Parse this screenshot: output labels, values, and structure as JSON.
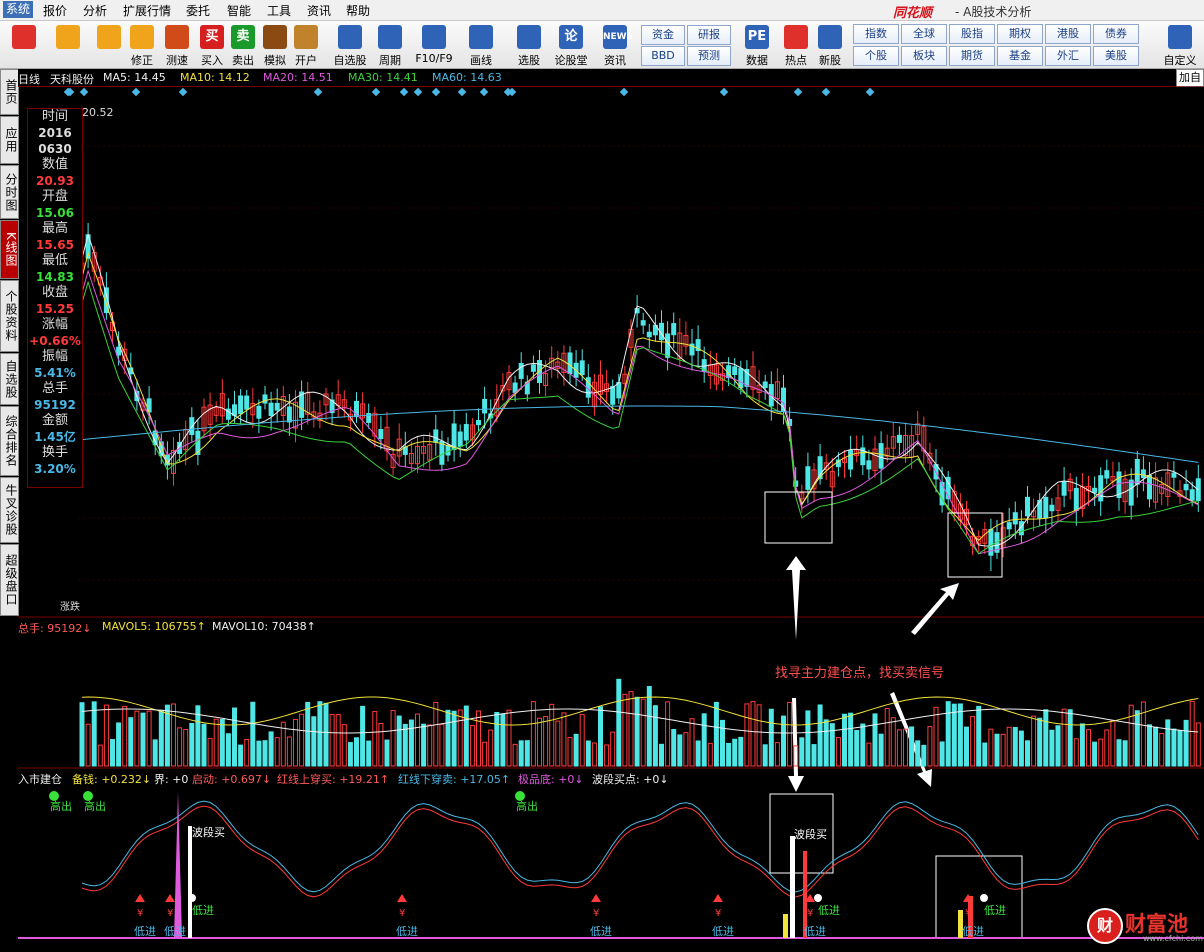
{
  "menubar": {
    "items": [
      "系统",
      "报价",
      "分析",
      "扩展行情",
      "委托",
      "智能",
      "工具",
      "资讯",
      "帮助"
    ],
    "brand": "同花顺",
    "subtitle": "- A股技术分析"
  },
  "toolbar": {
    "buttons": [
      {
        "label": "",
        "icon": "layout-icon",
        "color": "#e0302c"
      },
      {
        "label": "",
        "icon": "back-arrow-icon",
        "color": "#f0a41b"
      },
      {
        "label": "",
        "icon": "up-down-arrow-icon",
        "color": "#f0a41b"
      },
      {
        "label": "修正",
        "icon": "refresh-icon",
        "color": "#f0a41b"
      },
      {
        "label": "测速",
        "icon": "clock-icon",
        "color": "#d04a1a"
      },
      {
        "label": "买入",
        "icon": "buy-icon",
        "glyph": "买",
        "color": "#d62020"
      },
      {
        "label": "卖出",
        "icon": "sell-icon",
        "glyph": "卖",
        "color": "#1a9a2a"
      },
      {
        "label": "模拟",
        "icon": "hammer-icon",
        "color": "#8a4a12"
      },
      {
        "label": "开户",
        "icon": "lock-icon",
        "color": "#c0822a"
      },
      {
        "label": "自选股",
        "icon": "star-icon",
        "color": "#2f63b8"
      },
      {
        "label": "周期",
        "icon": "period-icon",
        "color": "#2f63b8"
      },
      {
        "label": "F10/F9",
        "icon": "f10-icon",
        "color": "#2f63b8"
      },
      {
        "label": "画线",
        "icon": "pen-icon",
        "color": "#2f63b8"
      },
      {
        "label": "选股",
        "icon": "screen-icon",
        "color": "#2f63b8"
      },
      {
        "label": "论股堂",
        "icon": "forum-icon",
        "glyph": "论",
        "color": "#2f63b8"
      },
      {
        "label": "资讯",
        "icon": "news-icon",
        "glyph": "NEWS",
        "color": "#2f63b8"
      },
      {
        "label": "数据",
        "icon": "pe-icon",
        "glyph": "PE",
        "color": "#2f63b8"
      },
      {
        "label": "热点",
        "icon": "hot-icon",
        "color": "#e0302c"
      },
      {
        "label": "新股",
        "icon": "new-stock-icon",
        "color": "#2f63b8"
      },
      {
        "label": "自定义",
        "icon": "custom-icon",
        "color": "#2f63b8"
      }
    ],
    "mid_buttons": [
      "资金",
      "研报",
      "BBD",
      "预测"
    ],
    "quick_buttons": [
      "指数",
      "全球",
      "股指",
      "期权",
      "港股",
      "债券",
      "个股",
      "板块",
      "期货",
      "基金",
      "外汇",
      "美股"
    ]
  },
  "sidetabs": [
    "首页",
    "应用",
    "分时图",
    "K线图",
    "个股资料",
    "自选股",
    "综合排名",
    "牛叉诊股",
    "超级盘口"
  ],
  "stock": {
    "period": "日线",
    "name": "天科股份",
    "ma": [
      {
        "label": "MA5: 14.45",
        "color": "#f0f0f0"
      },
      {
        "label": "MA10: 14.12",
        "color": "#f2e23a"
      },
      {
        "label": "MA20: 14.51",
        "color": "#e05ae0"
      },
      {
        "label": "MA30: 14.41",
        "color": "#3ad23a"
      },
      {
        "label": "MA60: 14.63",
        "color": "#4ab8e6"
      }
    ],
    "add_label": "加自"
  },
  "colors": {
    "up": "#ff3a3a",
    "down": "#4fe6e6",
    "ma5": "#f0f0f0",
    "ma10": "#f2e23a",
    "ma20": "#e05ae0",
    "ma30": "#3ad23a",
    "ma60": "#4ab8e6",
    "grid": "#7a0000"
  },
  "price_axis": {
    "max_label": "20.52",
    "tag": "涨跌"
  },
  "data_panel": [
    {
      "label": "时间",
      "value": "2016",
      "color": "#dddddd"
    },
    {
      "label": "",
      "value": "0630",
      "color": "#dddddd"
    },
    {
      "label": "数值",
      "value": "20.93",
      "color": "#ff3a3a"
    },
    {
      "label": "开盘",
      "value": "15.06",
      "color": "#3ae03a"
    },
    {
      "label": "最高",
      "value": "15.65",
      "color": "#ff3a3a"
    },
    {
      "label": "最低",
      "value": "14.83",
      "color": "#3ae03a"
    },
    {
      "label": "收盘",
      "value": "15.25",
      "color": "#ff3a3a"
    },
    {
      "label": "涨幅",
      "value": "+0.66%",
      "color": "#ff3a3a"
    },
    {
      "label": "振幅",
      "value": "5.41%",
      "color": "#4ab8e6"
    },
    {
      "label": "总手",
      "value": "95192",
      "color": "#4ab8e6"
    },
    {
      "label": "金额",
      "value": "1.45亿",
      "color": "#4ab8e6"
    },
    {
      "label": "换手",
      "value": "3.20%",
      "color": "#4ab8e6"
    }
  ],
  "volume": {
    "header": [
      {
        "label": "总手: 95192↓",
        "color": "#ff5a5a"
      },
      {
        "label": "MAVOL5: 106755↑",
        "color": "#f2e23a"
      },
      {
        "label": "MAVOL10: 70438↑",
        "color": "#f0f0f0"
      }
    ]
  },
  "indicator": {
    "title": [
      {
        "label": "入市建仓",
        "color": "#f0f0f0"
      },
      {
        "label": "备钱: +0.232↓",
        "color": "#f2e23a"
      },
      {
        "label": "界: +0",
        "color": "#f0f0f0"
      },
      {
        "label": "启动: +0.697↓",
        "color": "#ff5a5a"
      },
      {
        "label": "红线上穿买: +19.21↑",
        "color": "#ff5a5a"
      },
      {
        "label": "红线下穿卖: +17.05↑",
        "color": "#4ab8e6"
      },
      {
        "label": "极品底: +0↓",
        "color": "#e05ae0"
      },
      {
        "label": "波段买点: +0↓",
        "color": "#f0f0f0"
      }
    ],
    "high_label": "高出",
    "low_label": "低进",
    "wave_label": "波段买",
    "yen": "¥"
  },
  "annotation": "找寻主力建仓点，找买卖信号",
  "watermark": {
    "text": "财富池",
    "logo": "财",
    "url": "www.cfchi.com"
  }
}
